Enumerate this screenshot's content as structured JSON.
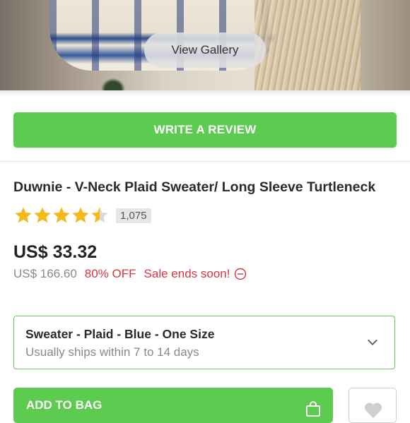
{
  "hero": {
    "gallery_label": "View Gallery"
  },
  "review": {
    "button_label": "WRITE A REVIEW"
  },
  "product": {
    "title": "Duwnie - V-Neck Plaid Sweater/ Long Sleeve Turtleneck",
    "rating": 4.5,
    "review_count": "1,075",
    "price": "US$ 33.32",
    "original_price": "US$ 166.60",
    "discount": "80% OFF",
    "sale_note": "Sale ends soon!"
  },
  "variant": {
    "name": "Sweater - Plaid - Blue - One Size",
    "shipping": "Usually ships within 7 to 14 days"
  },
  "actions": {
    "add_to_bag_label": "ADD TO BAG"
  },
  "colors": {
    "accent": "#5ccb4f",
    "star": "#f6b91b",
    "sale": "#d9363e"
  },
  "icons": [
    "star-icon",
    "clock-minus-icon",
    "chevron-down-icon",
    "shopping-bag-icon",
    "heart-icon"
  ]
}
